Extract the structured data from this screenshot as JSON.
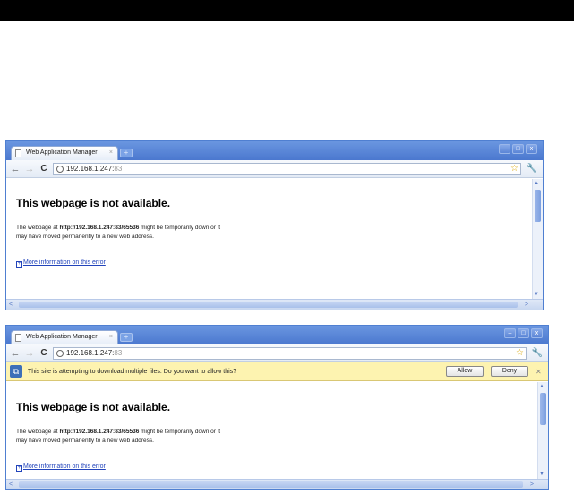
{
  "colors": {
    "topbar": "#000000",
    "window_frame": "#4f7fd1",
    "infobar_bg": "#fdf3b0",
    "link": "#2244bb"
  },
  "windows": [
    {
      "tab": {
        "title": "Web Application Manager",
        "icon": "page-icon",
        "close_label": "×"
      },
      "new_tab_label": "+",
      "controls": {
        "minimize": "–",
        "maximize": "□",
        "close": "x"
      },
      "toolbar": {
        "back": "←",
        "forward": "→",
        "reload": "C",
        "url_host": "192.168.1.247:",
        "url_port": "83",
        "star": "☆",
        "wrench": "🔧"
      },
      "error": {
        "title": "This webpage is not available.",
        "line1_prefix": "The webpage at ",
        "line1_url": "http://192.168.1.247:83/65536",
        "line1_suffix": " might be temporarily down or it",
        "line2": "may have moved permanently to a new web address.",
        "more_info": "More information on this error"
      }
    },
    {
      "tab": {
        "title": "Web Application Manager",
        "icon": "page-icon",
        "close_label": "×"
      },
      "new_tab_label": "+",
      "controls": {
        "minimize": "–",
        "maximize": "□",
        "close": "x"
      },
      "toolbar": {
        "back": "←",
        "forward": "→",
        "reload": "C",
        "url_host": "192.168.1.247:",
        "url_port": "83",
        "star": "☆",
        "wrench": "🔧"
      },
      "infobar": {
        "icon": "puzzle-icon",
        "message": "This site is attempting to download multiple files. Do you want to allow this?",
        "allow": "Allow",
        "deny": "Deny",
        "close": "✕"
      },
      "error": {
        "title": "This webpage is not available.",
        "line1_prefix": "The webpage at ",
        "line1_url": "http://192.168.1.247:83/65536",
        "line1_suffix": " might be temporarily down or it",
        "line2": "may have moved permanently to a new web address.",
        "more_info": "More information on this error"
      }
    }
  ]
}
